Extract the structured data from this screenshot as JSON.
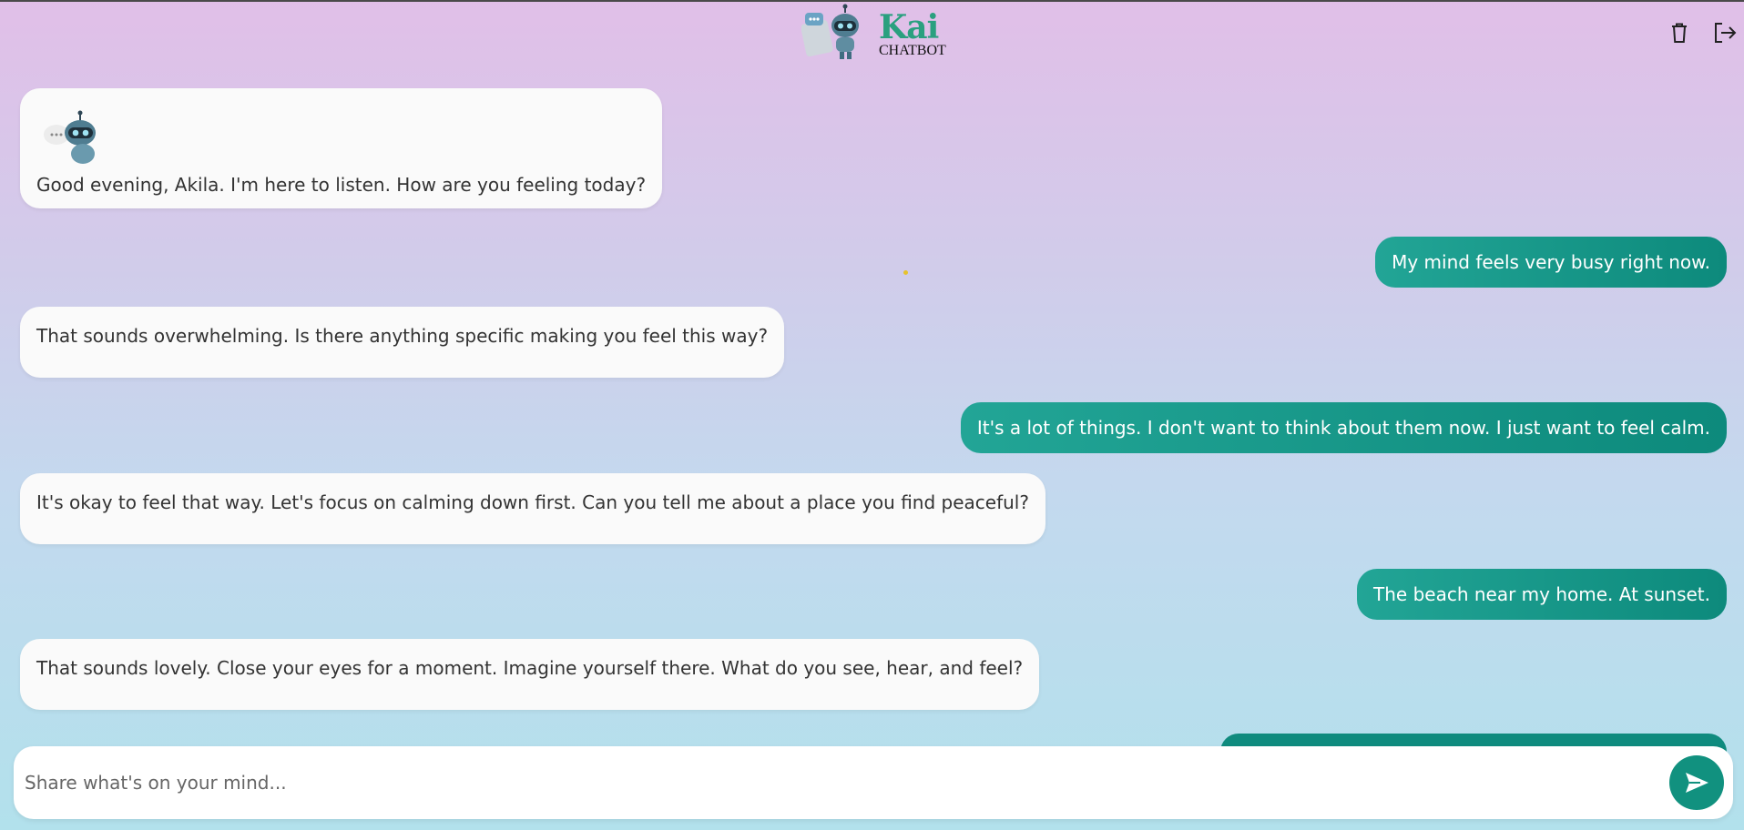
{
  "header": {
    "logo_title": "Kai",
    "logo_subtitle": "CHATBOT",
    "delete_icon": "trash-icon",
    "logout_icon": "logout-icon"
  },
  "messages": [
    {
      "role": "bot",
      "text": "Good evening, Akila. I'm here to listen. How are you feeling today?",
      "has_avatar": true
    },
    {
      "role": "user",
      "text": "My mind feels very busy right now."
    },
    {
      "role": "bot",
      "text": "That sounds overwhelming.  Is there anything specific making you feel this way?"
    },
    {
      "role": "user",
      "text": "It's a lot of things. I don't want to think about them now. I just want to feel calm."
    },
    {
      "role": "bot",
      "text": "It's okay to feel that way.  Let's focus on calming down first.  Can you tell me about a place you find peaceful?"
    },
    {
      "role": "user",
      "text": "The beach near my home. At sunset."
    },
    {
      "role": "bot",
      "text": "That sounds lovely.  Close your eyes for a moment. Imagine yourself there.  What do you see, hear, and feel?"
    }
  ],
  "input": {
    "placeholder": "Share what's on your mind...",
    "value": "",
    "send_icon": "send-icon"
  },
  "colors": {
    "accent": "#11917f",
    "user_bubble": "#1a9b8c",
    "bot_bubble": "#fafafa",
    "logo_green": "#2aa07f"
  }
}
